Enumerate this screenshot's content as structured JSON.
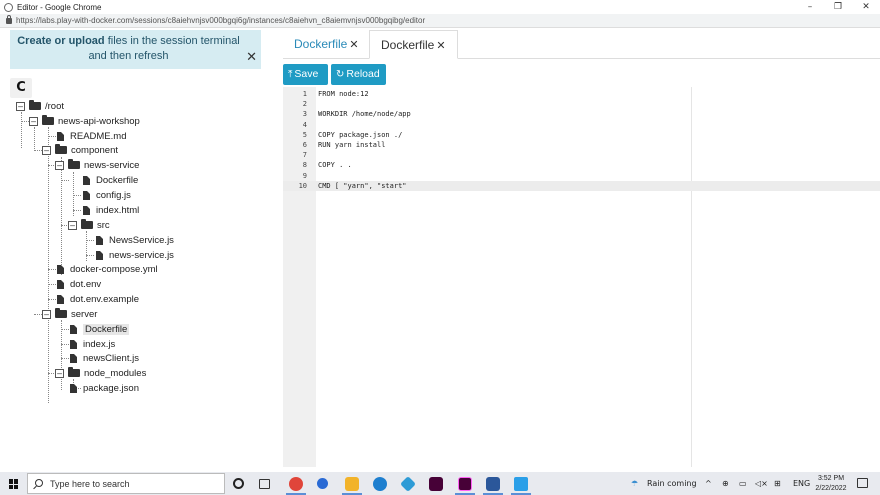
{
  "window": {
    "title": "Editor - Google Chrome",
    "controls": [
      "–",
      "❐",
      "✕"
    ]
  },
  "address_bar": {
    "url": "https://labs.play-with-docker.com/sessions/c8aiehvnjsv000bgqi6g/instances/c8aiehvn_c8aiemvnjsv000bgqibg/editor"
  },
  "notice": {
    "bold": "Create or upload",
    "rest": " files in the session terminal and then refresh",
    "close": "✕"
  },
  "refresh_button": "C",
  "tree": {
    "root": "/root",
    "news_api_workshop": "news-api-workshop",
    "readme": "README.md",
    "component": "component",
    "news_service": "news-service",
    "ns_dockerfile": "Dockerfile",
    "ns_config": "config.js",
    "ns_index_html": "index.html",
    "src": "src",
    "src_newsservice": "NewsService.js",
    "src_news_service": "news-service.js",
    "docker_compose": "docker-compose.yml",
    "dot_env": "dot.env",
    "dot_env_example": "dot.env.example",
    "server": "server",
    "server_dockerfile": "Dockerfile",
    "server_index": "index.js",
    "server_newsclient": "newsClient.js",
    "node_modules": "node_modules",
    "package_json": "package.json",
    "toggle_open": "–"
  },
  "tabs": [
    {
      "label": "Dockerfile",
      "close": "✕"
    },
    {
      "label": "Dockerfile",
      "close": "✕"
    }
  ],
  "toolbar": {
    "save_icon": "⤒",
    "save_label": "Save",
    "reload_icon": "↻",
    "reload_label": "Reload"
  },
  "editor": {
    "lines": [
      {
        "n": "1",
        "code": "FROM node:12"
      },
      {
        "n": "2",
        "code": ""
      },
      {
        "n": "3",
        "code": "WORKDIR /home/node/app"
      },
      {
        "n": "4",
        "code": ""
      },
      {
        "n": "5",
        "code": "COPY package.json ./"
      },
      {
        "n": "6",
        "code": "RUN yarn install"
      },
      {
        "n": "7",
        "code": ""
      },
      {
        "n": "8",
        "code": "COPY . ."
      },
      {
        "n": "9",
        "code": ""
      },
      {
        "n": "10",
        "code": "CMD [ \"yarn\", \"start\""
      }
    ]
  },
  "taskbar": {
    "search_placeholder": "Type here to search",
    "weather": "Rain coming",
    "lang": "ENG",
    "time": "3:52 PM",
    "date": "2/22/2022",
    "tray_icons": [
      "^",
      "⊕",
      "▭",
      "◁×",
      "⊞"
    ]
  }
}
